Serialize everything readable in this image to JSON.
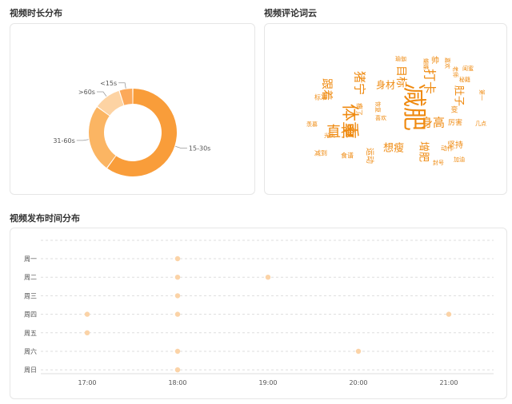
{
  "sections": {
    "duration_title": "视频时长分布",
    "wordcloud_title": "视频评论词云",
    "timeline_title": "视频发布时间分布"
  },
  "colors": {
    "donut": [
      "#f99d3a",
      "#fbb563",
      "#fdd3a3",
      "#fca95a"
    ],
    "word_orange": "#ef8a10",
    "timeline_dot": "#fbd3a7"
  },
  "chart_data": [
    {
      "type": "pie",
      "categories": [
        "15-30s",
        "31-60s",
        ">60s",
        "<15s"
      ],
      "values": [
        60,
        25,
        10,
        5
      ],
      "donut": true
    },
    {
      "type": "wordcloud",
      "words": [
        "减肥",
        "体重",
        "直播",
        "打卡",
        "猪宁",
        "身高",
        "目标",
        "跟着",
        "肚子",
        "想瘦",
        "增肥",
        "坚持",
        "运动",
        "厉害",
        "动作",
        "标准",
        "减到",
        "食谱",
        "瘦了",
        "几点",
        "封号",
        "加油",
        "蝴蝶",
        "嘉欢",
        "帅",
        "老师",
        "喜欢",
        "变",
        "第一",
        "光头",
        "羡慕",
        "瑜伽",
        "闺蜜",
        "身材",
        "恢复",
        "秘籍"
      ]
    },
    {
      "type": "scatter",
      "x_ticks": [
        "17:00",
        "18:00",
        "19:00",
        "20:00",
        "21:00"
      ],
      "y_categories": [
        "周一",
        "周二",
        "周三",
        "周四",
        "周五",
        "周六",
        "周日"
      ],
      "points": [
        {
          "x": "18:00",
          "y": "周一"
        },
        {
          "x": "18:00",
          "y": "周二"
        },
        {
          "x": "19:00",
          "y": "周二"
        },
        {
          "x": "18:00",
          "y": "周三"
        },
        {
          "x": "17:00",
          "y": "周四"
        },
        {
          "x": "18:00",
          "y": "周四"
        },
        {
          "x": "21:00",
          "y": "周四"
        },
        {
          "x": "17:00",
          "y": "周五"
        },
        {
          "x": "18:00",
          "y": "周六"
        },
        {
          "x": "20:00",
          "y": "周六"
        },
        {
          "x": "18:00",
          "y": "周日"
        }
      ],
      "grid": true
    }
  ]
}
